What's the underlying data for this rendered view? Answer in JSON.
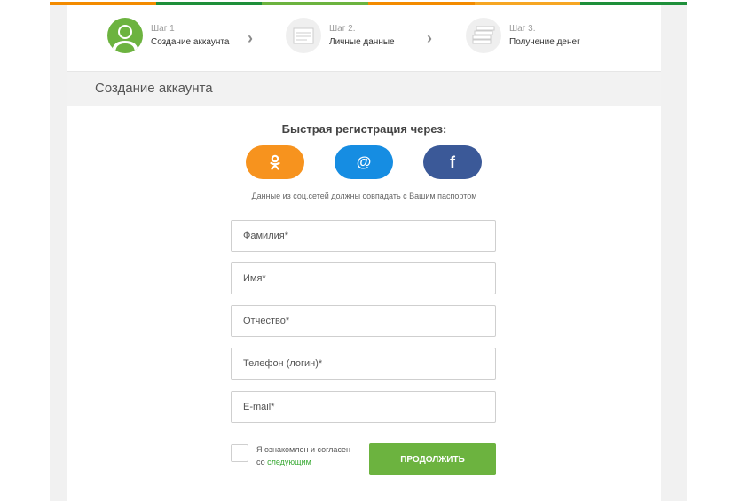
{
  "steps": [
    {
      "num": "Шаг 1",
      "label": "Создание аккаунта",
      "icon": "user-icon"
    },
    {
      "num": "Шаг 2.",
      "label": "Личные данные",
      "icon": "document-icon"
    },
    {
      "num": "Шаг 3.",
      "label": "Получение денег",
      "icon": "money-stack-icon"
    }
  ],
  "section_title": "Создание аккаунта",
  "quick_reg": {
    "title": "Быстрая регистрация через:",
    "buttons": [
      {
        "name": "odnoklassniki",
        "icon": "odnoklassniki-icon",
        "color": "#f7931e"
      },
      {
        "name": "mail",
        "icon": "at-icon",
        "glyph": "@",
        "color": "#168de2"
      },
      {
        "name": "facebook",
        "icon": "facebook-icon",
        "glyph": "f",
        "color": "#3b5998"
      }
    ],
    "note": "Данные из соц.сетей должны совпадать с Вашим паспортом"
  },
  "form": {
    "fields": [
      {
        "placeholder": "Фамилия*",
        "value": ""
      },
      {
        "placeholder": "Имя*",
        "value": ""
      },
      {
        "placeholder": "Отчество*",
        "value": ""
      },
      {
        "placeholder": "Телефон (логин)*",
        "value": ""
      },
      {
        "placeholder": "E-mail*",
        "value": ""
      }
    ],
    "agree_text": "Я ознакомлен и согласен",
    "agree_prefix": "со",
    "agree_link": "следующим",
    "agree_checked": false,
    "submit_label": "ПРОДОЛЖИТЬ"
  },
  "colors": {
    "accent_green": "#6cb33f",
    "link_green": "#3aaa35",
    "orange": "#f7931e",
    "blue": "#168de2",
    "facebook_blue": "#3b5998"
  }
}
